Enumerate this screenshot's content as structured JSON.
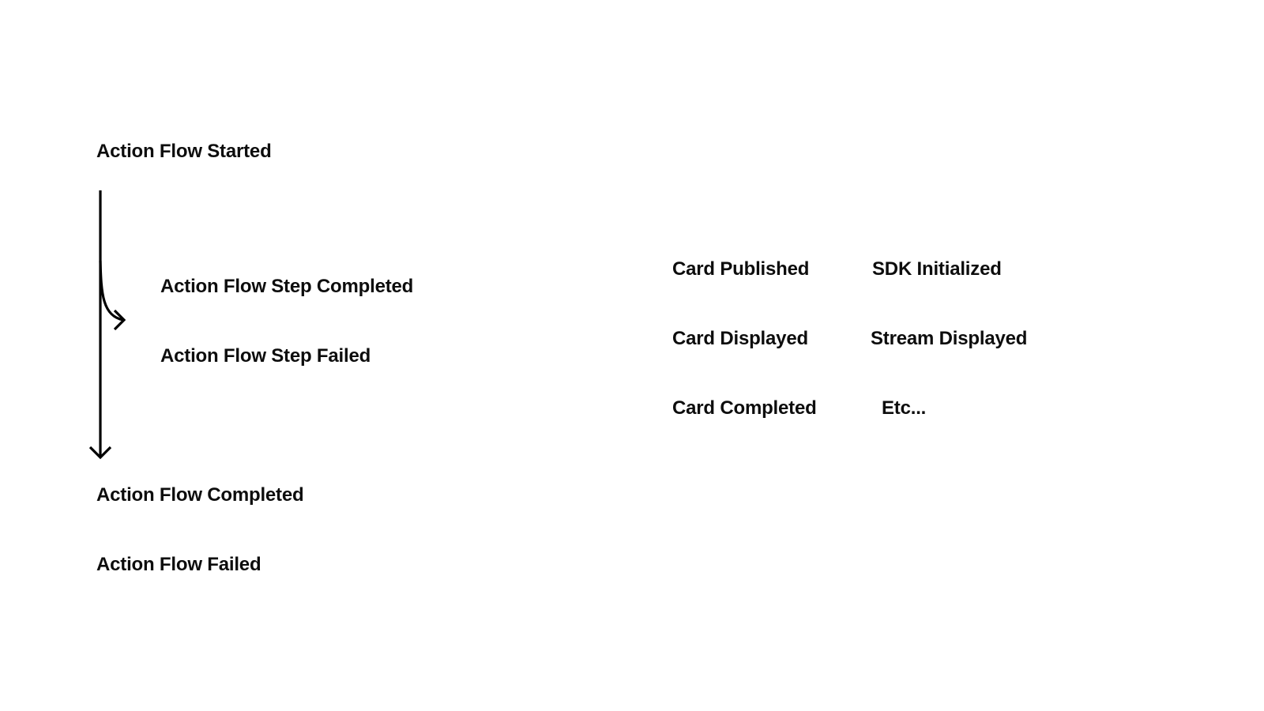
{
  "flow": {
    "start": "Action Flow Started",
    "steps": [
      "Action Flow Step Completed",
      "Action Flow Step Failed"
    ],
    "end": [
      "Action Flow Completed",
      "Action Flow Failed"
    ]
  },
  "other_events": {
    "column_1": [
      "Card Published",
      "Card Displayed",
      "Card Completed"
    ],
    "column_2": [
      "SDK Initialized",
      "Stream Displayed",
      "Etc..."
    ]
  },
  "colors": {
    "text": "#0d0d0d",
    "arrow": "#000000",
    "background": "#ffffff"
  }
}
